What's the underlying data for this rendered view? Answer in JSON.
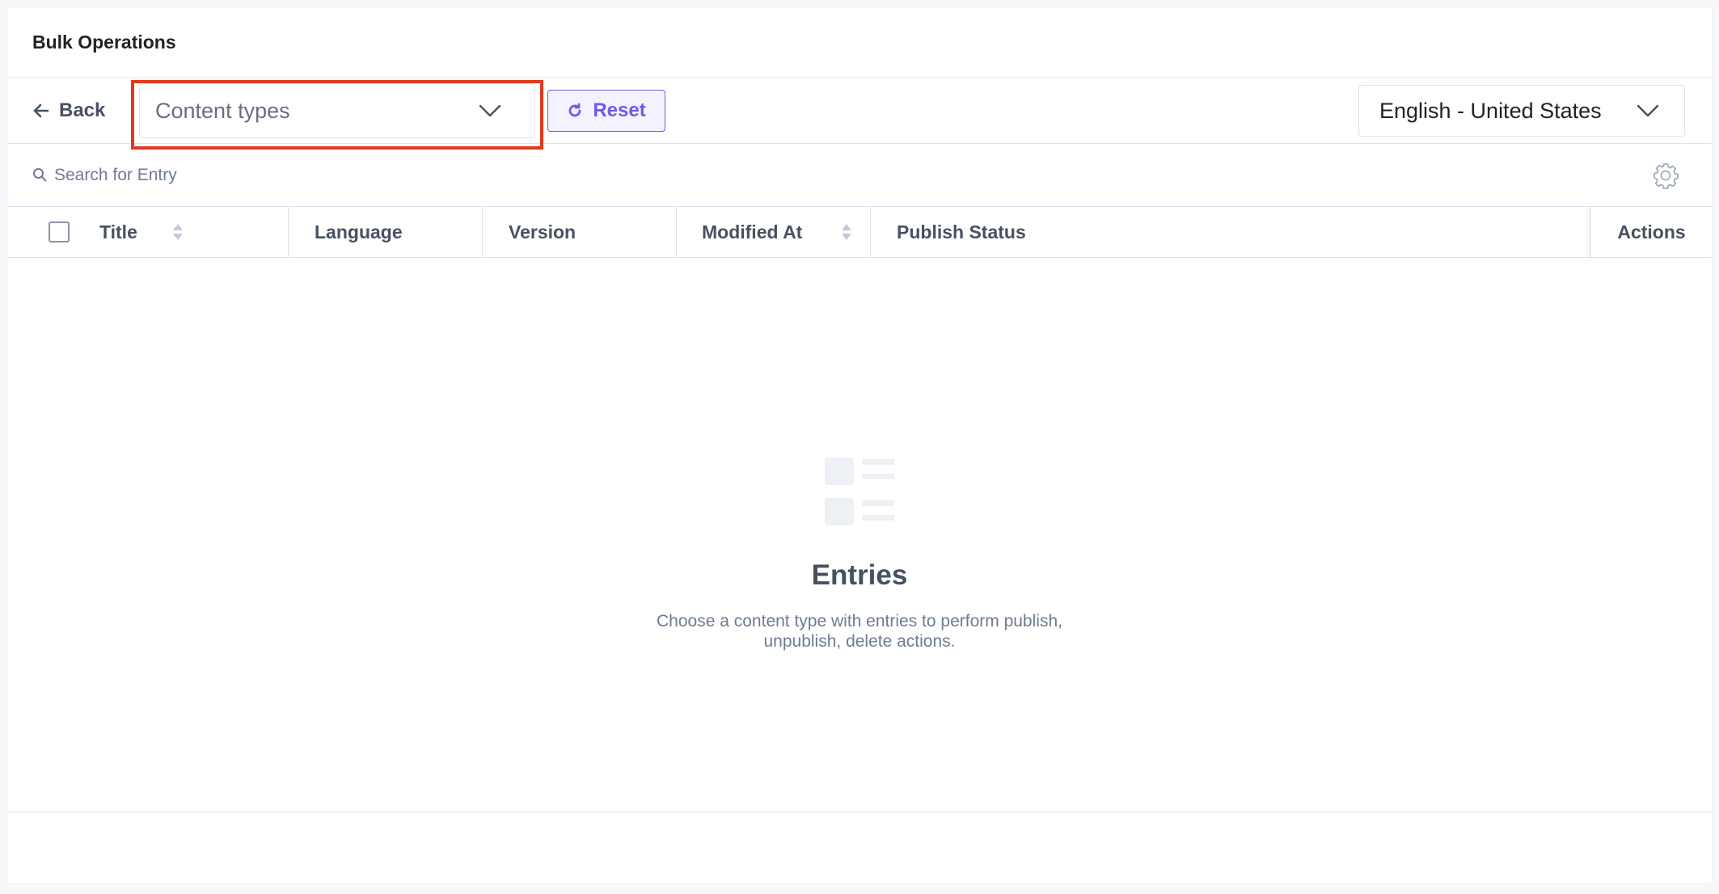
{
  "panel": {
    "title": "Bulk Operations"
  },
  "toolbar": {
    "back_label": "Back",
    "content_type_select": "Content types",
    "reset_label": "Reset",
    "locale_select": "English - United States"
  },
  "search": {
    "placeholder": "Search for Entry"
  },
  "table": {
    "columns": [
      "Title",
      "Language",
      "Version",
      "Modified At",
      "Publish Status"
    ],
    "actions_label": "Actions",
    "sortable": [
      "Title",
      "Modified At"
    ]
  },
  "empty_state": {
    "title": "Entries",
    "description": "Choose a content type with entries to perform publish, unpublish, delete actions."
  },
  "colors": {
    "accent": "#6c5ce7",
    "highlight": "#e2391f",
    "text": "#475161"
  },
  "icons": [
    "arrow-left-icon",
    "chevron-down-icon",
    "refresh-icon",
    "search-icon",
    "gear-icon",
    "sort-icon",
    "entries-list-icon"
  ]
}
